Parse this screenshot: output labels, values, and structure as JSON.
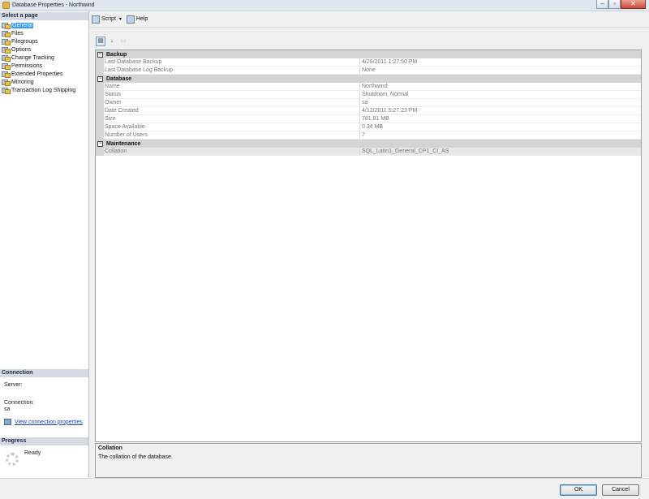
{
  "window": {
    "title": "Database Properties - Northwind",
    "min_glyph": "–",
    "max_glyph": "▫",
    "close_glyph": "✕"
  },
  "left": {
    "pages_header": "Select a page",
    "pages": [
      "General",
      "Files",
      "Filegroups",
      "Options",
      "Change Tracking",
      "Permissions",
      "Extended Properties",
      "Mirroring",
      "Transaction Log Shipping"
    ],
    "selected_page": "General",
    "connection_header": "Connection",
    "server_label": "Server:",
    "server_value": "",
    "connection_label": "Connection:",
    "connection_value": "sa",
    "view_connection_link": "View connection properties",
    "progress_header": "Progress",
    "progress_status": "Ready"
  },
  "toolbar": {
    "script_label": "Script",
    "script_arrow": "▾",
    "help_label": "Help"
  },
  "gridtools": {
    "categorized_glyph": "▤",
    "alphabetical_glyph": "↓",
    "pages_glyph": "▭"
  },
  "grid": {
    "categories": [
      {
        "name": "Backup",
        "toggle": "−",
        "rows": [
          {
            "name": "Last Database Backup",
            "value": "4/28/2011 1:27:50 PM"
          },
          {
            "name": "Last Database Log Backup",
            "value": "None"
          }
        ]
      },
      {
        "name": "Database",
        "toggle": "−",
        "rows": [
          {
            "name": "Name",
            "value": "Northwind"
          },
          {
            "name": "Status",
            "value": "Shutdown, Normal"
          },
          {
            "name": "Owner",
            "value": "sa"
          },
          {
            "name": "Date Created",
            "value": "4/12/2011 5:27:23 PM"
          },
          {
            "name": "Size",
            "value": "781.81 MB"
          },
          {
            "name": "Space Available",
            "value": "0.34 MB"
          },
          {
            "name": "Number of Users",
            "value": "7"
          }
        ]
      },
      {
        "name": "Maintenance",
        "toggle": "−",
        "rows": [
          {
            "name": "Collation",
            "value": "SQL_Latin1_General_CP1_CI_AS"
          }
        ]
      }
    ]
  },
  "description": {
    "title": "Collation",
    "text": "The collation of the database."
  },
  "buttons": {
    "ok": "OK",
    "cancel": "Cancel"
  }
}
